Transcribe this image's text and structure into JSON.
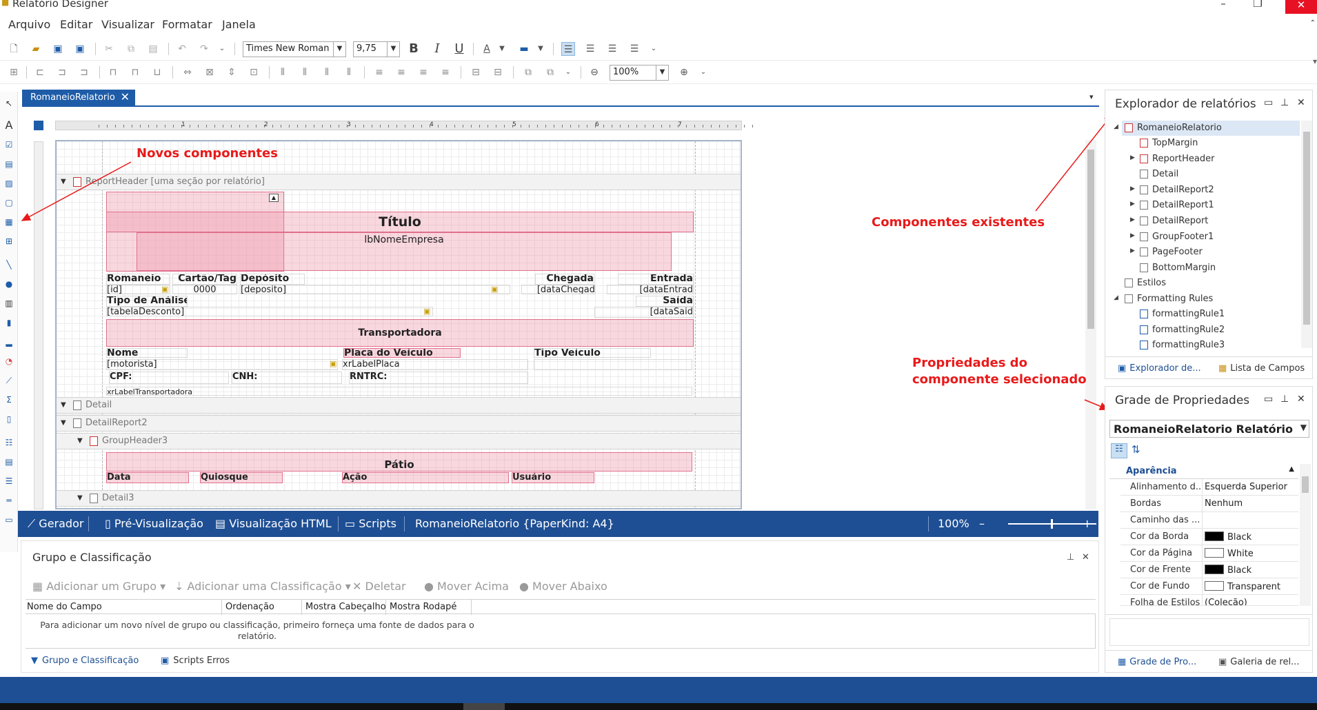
{
  "window": {
    "title": "Relatório Designer",
    "minimize": "–",
    "restore": "❐",
    "close": "✕"
  },
  "menu": [
    "Arquivo",
    "Editar",
    "Visualizar",
    "Formatar",
    "Janela"
  ],
  "toolbar": {
    "font_name": "Times New Roman",
    "font_size": "9,75",
    "bold": "B",
    "italic": "I",
    "underline": "U",
    "zoom": "100%"
  },
  "doc_tab": {
    "label": "RomaneioRelatorio",
    "close": "✕"
  },
  "ruler": [
    "1",
    "2",
    "3",
    "4",
    "5",
    "6",
    "7"
  ],
  "bands": {
    "report_header": "ReportHeader [uma seção por relatório]",
    "detail": "Detail",
    "detail_report2": "DetailReport2",
    "group_header3": "GroupHeader3",
    "detail3": "Detail3"
  },
  "controls": {
    "titulo": "Título",
    "nome_empresa": "lbNomeEmpresa",
    "romaneio": "Romaneio",
    "cartao": "Cartão/Tag",
    "deposito": "Depósito",
    "chegada": "Chegada",
    "entrada": "Entrada",
    "id": "[id]",
    "zero": "0000",
    "deposito_field": "[deposito]",
    "data_chegada": "[dataChegad",
    "data_entrada": "[dataEntrad",
    "tipo_analise": "Tipo de Análise",
    "saida": "Saída",
    "tabela_desconto": "[tabelaDesconto]",
    "data_saida": "[dataSaid",
    "transportadora": "Transportadora",
    "nome": "Nome",
    "placa": "Placa do Veículo",
    "tipo_veiculo": "Tipo Veículo",
    "motorista": "[motorista]",
    "label_placa": "xrLabelPlaca",
    "cpf": "CPF:",
    "cnh": "CNH:",
    "rntrc": "RNTRC:",
    "label_transportadora": "xrLabelTransportadora",
    "patio": "Pátio",
    "data": "Data",
    "quiosque": "Quiosque",
    "acao": "Ação",
    "usuario": "Usuário"
  },
  "annotations": {
    "novos": "Novos componentes",
    "existentes": "Componentes existentes",
    "propriedades_l1": "Propriedades do",
    "propriedades_l2": "componente selecionado"
  },
  "statusbar": {
    "gerador": "Gerador",
    "pre": "Pré-Visualização",
    "html": "Visualização HTML",
    "scripts": "Scripts",
    "info": "RomaneioRelatorio {PaperKind: A4}",
    "zoom": "100%",
    "minus": "–",
    "plus": "+"
  },
  "group_panel": {
    "title": "Grupo e Classificação",
    "add_group": "Adicionar um Grupo",
    "add_sort": "Adicionar uma Classificação",
    "delete": "Deletar",
    "move_up": "Mover Acima",
    "move_down": "Mover Abaixo",
    "columns": [
      "Nome do Campo",
      "Ordenação",
      "Mostra Cabeçalho",
      "Mostra Rodapé"
    ],
    "empty_message": "Para adicionar um novo nível de grupo ou classificação, primeiro forneça uma fonte de dados para o relatório.",
    "tab_group": "Grupo e Classificação",
    "tab_scripts": "Scripts Erros"
  },
  "explorer": {
    "title": "Explorador de relatórios",
    "items": [
      "RomaneioRelatorio",
      "TopMargin",
      "ReportHeader",
      "Detail",
      "DetailReport2",
      "DetailReport1",
      "DetailReport",
      "GroupFooter1",
      "PageFooter",
      "BottomMargin",
      "Estilos",
      "Formatting Rules",
      "formattingRule1",
      "formattingRule2",
      "formattingRule3"
    ],
    "tab_explorer": "Explorador de...",
    "tab_fields": "Lista de Campos"
  },
  "properties": {
    "title": "Grade de Propriedades",
    "selected": "RomaneioRelatorio   Relatório",
    "category": "Aparência",
    "rows": [
      {
        "name": "Alinhamento d...",
        "value": "Esquerda Superior"
      },
      {
        "name": "Bordas",
        "value": "Nenhum"
      },
      {
        "name": "Caminho das ...",
        "value": ""
      },
      {
        "name": "Cor da Borda",
        "value": "Black"
      },
      {
        "name": "Cor da Página",
        "value": "White"
      },
      {
        "name": "Cor de Frente",
        "value": "Black"
      },
      {
        "name": "Cor de Fundo",
        "value": "Transparent"
      },
      {
        "name": "Folha de Estilos",
        "value": "(Coleção)"
      }
    ],
    "tab_props": "Grade de Pro...",
    "tab_gallery": "Galeria de rel..."
  },
  "colors": {
    "accent": "#1e5ca8",
    "status": "#1e4f94",
    "annotation": "#e81a1a",
    "control_pink": "#f096aa"
  }
}
